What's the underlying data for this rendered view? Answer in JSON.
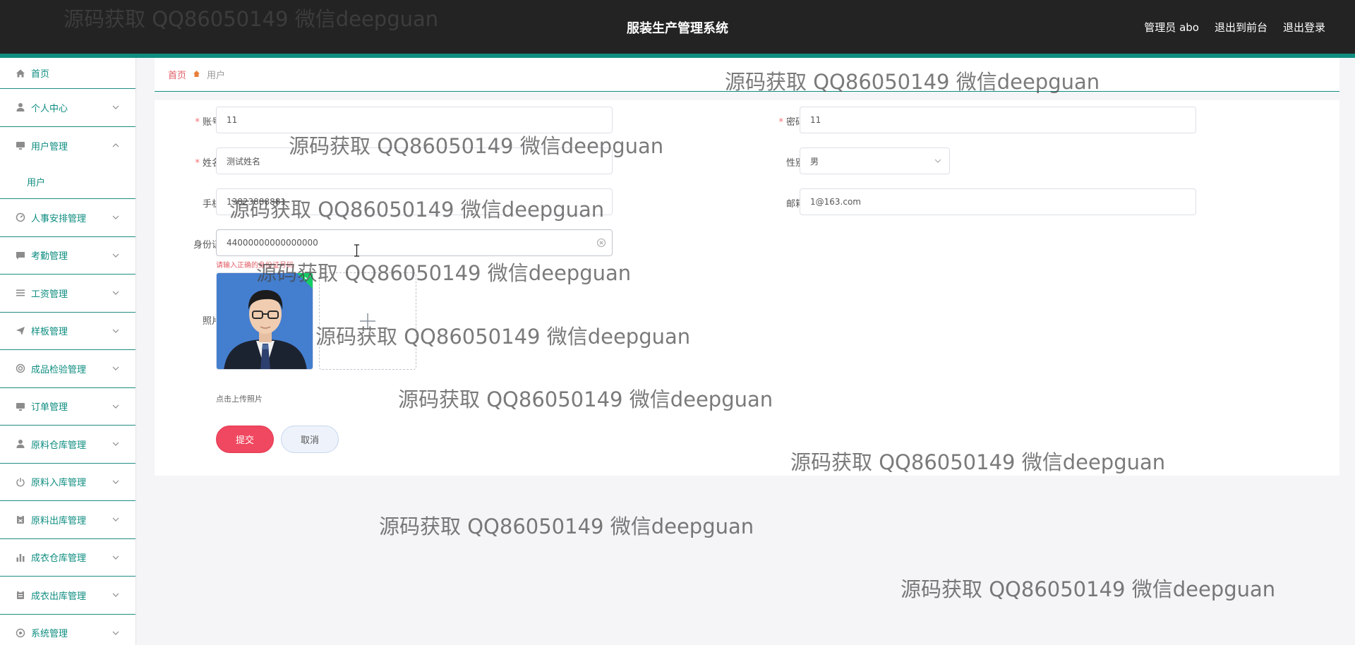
{
  "header": {
    "title": "服装生产管理系统",
    "admin_label": "管理员 abo",
    "to_front": "退出到前台",
    "logout": "退出登录"
  },
  "sidebar": {
    "home": "首页",
    "items": [
      {
        "label": "个人中心",
        "icon": "person-icon"
      },
      {
        "label": "用户管理",
        "icon": "monitor-icon",
        "expanded": true,
        "children": [
          "用户"
        ]
      },
      {
        "label": "人事安排管理",
        "icon": "gauge-icon"
      },
      {
        "label": "考勤管理",
        "icon": "chat-icon"
      },
      {
        "label": "工资管理",
        "icon": "list-icon"
      },
      {
        "label": "样板管理",
        "icon": "send-icon"
      },
      {
        "label": "成品检验管理",
        "icon": "target-icon"
      },
      {
        "label": "订单管理",
        "icon": "monitor-icon"
      },
      {
        "label": "原料仓库管理",
        "icon": "person-icon"
      },
      {
        "label": "原料入库管理",
        "icon": "power-icon"
      },
      {
        "label": "原料出库管理",
        "icon": "clipboard-icon"
      },
      {
        "label": "成衣仓库管理",
        "icon": "bar-chart-icon"
      },
      {
        "label": "成衣出库管理",
        "icon": "clipboard-icon"
      },
      {
        "label": "系统管理",
        "icon": "gear-icon"
      }
    ]
  },
  "breadcrumb": {
    "home": "首页",
    "current": "用户"
  },
  "form": {
    "account": {
      "label": "账号",
      "value": "11"
    },
    "password": {
      "label": "密码",
      "value": "11"
    },
    "name": {
      "label": "姓名",
      "value": "测试姓名"
    },
    "gender": {
      "label": "性别",
      "value": "男"
    },
    "phone": {
      "label": "手机",
      "value": "13823888881"
    },
    "email": {
      "label": "邮箱",
      "value": "1@163.com"
    },
    "idcard": {
      "label": "身份证",
      "value": "44000000000000000"
    },
    "idcard_error": "请输入正确的身份证号码",
    "photo": {
      "label": "照片",
      "hint": "点击上传照片"
    },
    "submit": "提交",
    "cancel": "取消"
  },
  "watermark": "源码获取 QQ86050149 微信deepguan",
  "colors": {
    "header_bg": "#232323",
    "accent": "#0e8d80",
    "submit": "#f04860",
    "error": "#e15d65"
  }
}
